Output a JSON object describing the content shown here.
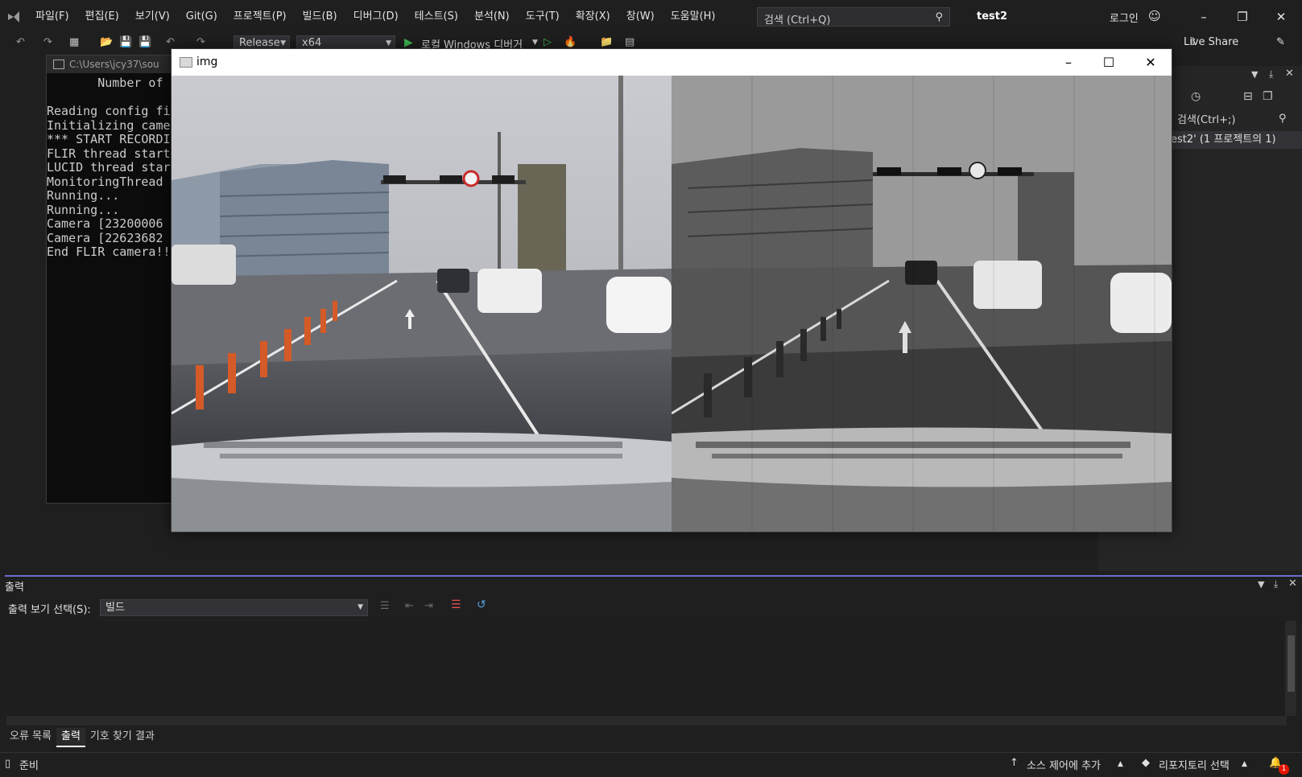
{
  "app": {
    "menu": [
      "파일(F)",
      "편집(E)",
      "보기(V)",
      "Git(G)",
      "프로젝트(P)",
      "빌드(B)",
      "디버그(D)",
      "테스트(S)",
      "분석(N)",
      "도구(T)",
      "확장(X)",
      "창(W)",
      "도움말(H)"
    ],
    "search_placeholder": "검색 (Ctrl+Q)",
    "solution_name": "test2",
    "login": "로그인"
  },
  "toolbar": {
    "config": "Release",
    "platform": "x64",
    "run_label": "로컬 Windows 디버거",
    "live_share": "Live Share"
  },
  "console": {
    "title": "C:\\Users\\jcy37\\sou",
    "lines": [
      "       Number of",
      "",
      "Reading config fi",
      "Initializing came",
      "*** START RECORDI",
      "FLIR thread start",
      "LUCID thread star",
      "MonitoringThread ",
      "Running...",
      "Running...",
      "Camera [23200006",
      "Camera [22623682",
      "End FLIR camera!!"
    ]
  },
  "solution_explorer": {
    "search": "검색(Ctrl+;)",
    "item": "est2' (1 프로젝트의 1)"
  },
  "img_window": {
    "title": "img"
  },
  "output": {
    "title": "출력",
    "show_label": "출력 보기 선택(S):",
    "source": "빌드"
  },
  "bottom_tabs": [
    "오류 목록",
    "출력",
    "기호 찾기 결과"
  ],
  "status": {
    "ready": "준비",
    "source_control": "소스 제어에 추가",
    "repository": "리포지토리 선택",
    "notifications": "1"
  },
  "colors": {
    "background": "#1f1f1f",
    "accent": "#6c6cd0",
    "run_green": "#3fb950",
    "notification_red": "#e51400"
  }
}
